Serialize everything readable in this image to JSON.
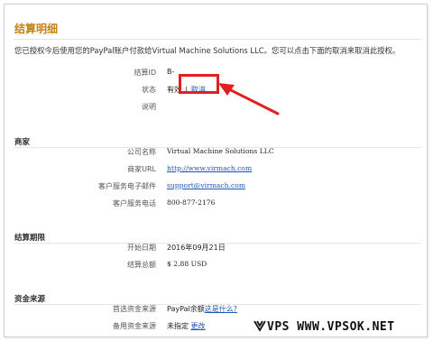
{
  "page": {
    "title": "结算明细",
    "notice": "您已授权今后使用您的PayPal账户付款给Virtual Machine Solutions LLC。您可以点击下面的取消来取消此授权。"
  },
  "details": {
    "id_label": "结算ID",
    "id_value": "B-",
    "status_label": "状态",
    "status_value": "有效",
    "status_separator": "|",
    "cancel_link": "取消",
    "note_label": "说明"
  },
  "merchant": {
    "section_title": "商家",
    "company_label": "公司名称",
    "company_value": "Virtual Machine Solutions LLC",
    "url_label": "商家URL",
    "url_value": "http://www.virmach.com",
    "email_label": "客户服务电子邮件",
    "email_value": "support@virmach.com",
    "phone_label": "客户服务电话",
    "phone_value": "800-877-2176"
  },
  "period": {
    "section_title": "结算期限",
    "start_label": "开始日期",
    "start_value": "2016年09月21日",
    "total_label": "结算总额",
    "total_value": "$ 2.88 USD"
  },
  "funding": {
    "section_title": "资金来源",
    "preferred_label": "首选资金来源",
    "preferred_value": "PayPal余额",
    "preferred_link": "这是什么?",
    "backup_label": "备用资金来源",
    "backup_value": "未指定",
    "backup_link": "更改"
  },
  "annotation": {
    "highlight_color": "#e02020"
  },
  "watermark": {
    "text": "VPS WWW.VPSOK.NET"
  },
  "colors": {
    "title": "#c8800c",
    "link": "#1a57b5"
  }
}
